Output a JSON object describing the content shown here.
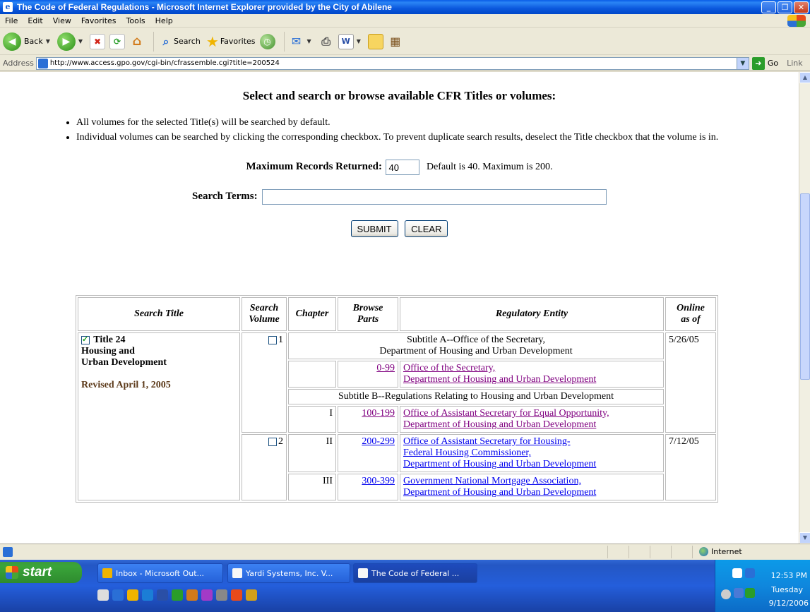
{
  "window": {
    "title": "The Code of Federal Regulations - Microsoft Internet Explorer provided by the City of Abilene"
  },
  "menu": [
    "File",
    "Edit",
    "View",
    "Favorites",
    "Tools",
    "Help"
  ],
  "toolbar": {
    "back_label": "Back",
    "search_label": "Search",
    "favorites_label": "Favorites"
  },
  "address": {
    "label": "Address",
    "url": "http://www.access.gpo.gov/cgi-bin/cfrassemble.cgi?title=200524",
    "go_label": "Go",
    "links_label": "Link"
  },
  "page": {
    "heading": "Select and search or browse available CFR Titles or volumes:",
    "bullets": [
      "All volumes for the selected Title(s) will be searched by default.",
      "Individual volumes can be searched by clicking the corresponding checkbox. To prevent duplicate search results, deselect the Title checkbox that the volume is in."
    ],
    "max_label": "Maximum Records Returned:",
    "max_value": "40",
    "max_note": "Default is 40. Maximum is 200.",
    "search_label": "Search Terms:",
    "search_value": "",
    "submit_label": "SUBMIT",
    "clear_label": "CLEAR"
  },
  "table": {
    "headers": {
      "search_title": "Search Title",
      "search_volume_1": "Search",
      "search_volume_2": "Volume",
      "chapter": "Chapter",
      "browse_1": "Browse",
      "browse_2": "Parts",
      "entity": "Regulatory Entity",
      "online_1": "Online",
      "online_2": "as of"
    },
    "title": {
      "name": "Title 24",
      "subject_1": "Housing and",
      "subject_2": "Urban Development",
      "revised": "Revised April 1, 2005"
    },
    "rows": {
      "vol1": "1",
      "vol1_date": "5/26/05",
      "subtitleA_1": "Subtitle A--Office of the Secretary,",
      "subtitleA_2": "Department of Housing and Urban Development",
      "r1_parts": "0-99",
      "r1_entity_1": "Office of the Secretary,",
      "r1_entity_2": "Department of Housing and Urban Development",
      "subtitleB": "Subtitle B--Regulations Relating to Housing and Urban Development",
      "r2_chapter": "I",
      "r2_parts": "100-199",
      "r2_entity_1": "Office of Assistant Secretary for Equal Opportunity,",
      "r2_entity_2": "Department of Housing and Urban Development",
      "vol2": "2",
      "vol2_date": "7/12/05",
      "r3_chapter": "II",
      "r3_parts": "200-299",
      "r3_entity_1": "Office of Assistant Secretary for Housing-",
      "r3_entity_2": "Federal Housing Commissioner,",
      "r3_entity_3": "Department of Housing and Urban Development",
      "r4_chapter": "III",
      "r4_parts": "300-399",
      "r4_entity_1": "Government National Mortgage Association,",
      "r4_entity_2": "Department of Housing and Urban Development"
    }
  },
  "status": {
    "zone": "Internet"
  },
  "taskbar": {
    "start": "start",
    "tasks": [
      "Inbox - Microsoft Out...",
      "Yardi Systems, Inc. V...",
      "The Code of Federal ..."
    ],
    "time": "12:53 PM",
    "day": "Tuesday",
    "date": "9/12/2006"
  }
}
